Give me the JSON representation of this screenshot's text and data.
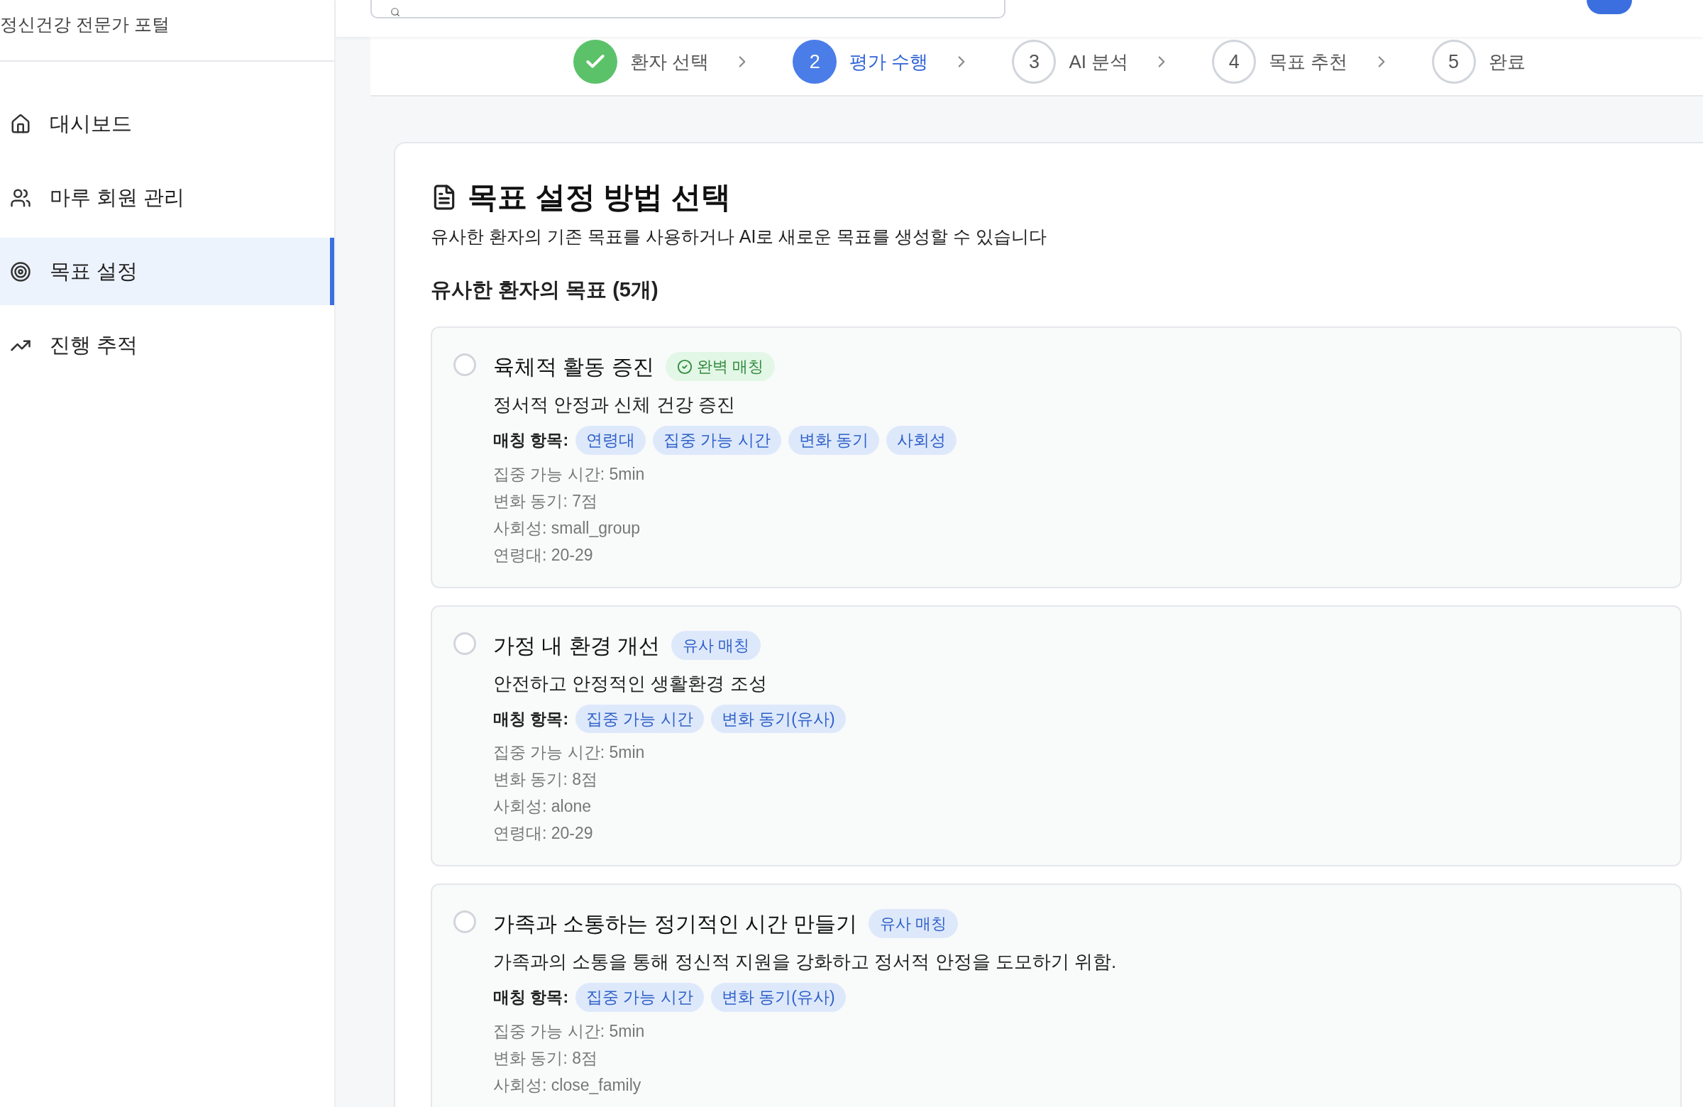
{
  "sidebar": {
    "subtitle": "정신건강 전문가 포털",
    "items": [
      {
        "label": "대시보드",
        "selected": false
      },
      {
        "label": "마루 회원 관리",
        "selected": false
      },
      {
        "label": "목표 설정",
        "selected": true
      },
      {
        "label": "진행 추적",
        "selected": false
      }
    ]
  },
  "stepper": [
    {
      "label": "환자 선택",
      "kind": "done"
    },
    {
      "number": "2",
      "label": "평가 수행",
      "kind": "current"
    },
    {
      "number": "3",
      "label": "AI 분석",
      "kind": "pending"
    },
    {
      "number": "4",
      "label": "목표 추천",
      "kind": "pending"
    },
    {
      "number": "5",
      "label": "완료",
      "kind": "pending"
    }
  ],
  "panel": {
    "title": "목표 설정 방법 선택",
    "subtitle": "유사한 환자의 기존 목표를 사용하거나 AI로 새로운 목표를 생성할 수 있습니다",
    "section_title": "유사한 환자의 목표 (5개)",
    "goals": [
      {
        "title": "육체적 활동 증진",
        "badge": "완벽 매칭",
        "kind": "perfect",
        "selected": false,
        "description": "정서적 안정과 신체 건강 증진",
        "match_label": "매칭 항목:",
        "tags": [
          "연령대",
          "집중 가능 시간",
          "변화 동기",
          "사회성"
        ],
        "details": [
          "집중 가능 시간: 5min",
          "변화 동기: 7점",
          "사회성: small_group",
          "연령대: 20-29"
        ]
      },
      {
        "title": "가정 내 환경 개선",
        "badge": "유사 매칭",
        "kind": "similar",
        "selected": false,
        "description": "안전하고 안정적인 생활환경 조성",
        "match_label": "매칭 항목:",
        "tags": [
          "집중 가능 시간",
          "변화 동기(유사)"
        ],
        "details": [
          "집중 가능 시간: 5min",
          "변화 동기: 8점",
          "사회성: alone",
          "연령대: 20-29"
        ]
      },
      {
        "title": "가족과 소통하는 정기적인 시간 만들기",
        "badge": "유사 매칭",
        "kind": "similar",
        "selected": false,
        "description": "가족과의 소통을 통해 정신적 지원을 강화하고 정서적 안정을 도모하기 위함.",
        "match_label": "매칭 항목:",
        "tags": [
          "집중 가능 시간",
          "변화 동기(유사)"
        ],
        "details": [
          "집중 가능 시간: 5min",
          "변화 동기: 8점",
          "사회성: close_family"
        ]
      }
    ]
  }
}
